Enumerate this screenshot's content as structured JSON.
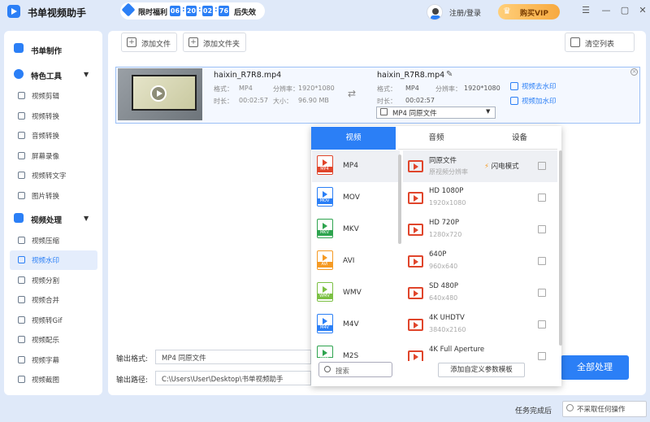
{
  "app": {
    "title": "书单视频助手"
  },
  "promo": {
    "label": "限时福利",
    "days": "06",
    "hours": "20",
    "minutes": "02",
    "seconds": "76",
    "suffix": "后失效"
  },
  "header": {
    "login": "注册/登录",
    "vip": "购买VIP"
  },
  "sidebar": {
    "top_item": "书单制作",
    "groups": [
      {
        "label": "特色工具",
        "items": [
          "视频剪辑",
          "视频转换",
          "音频转换",
          "屏幕录像",
          "视频转文字",
          "图片转换"
        ]
      },
      {
        "label": "视频处理",
        "items": [
          "视频压缩",
          "视频水印",
          "视频分割",
          "视频合并",
          "视频转Gif",
          "视频配乐",
          "视频字幕",
          "视频截图"
        ]
      }
    ],
    "active_item": "视频水印"
  },
  "toolbar": {
    "add_file": "添加文件",
    "add_folder": "添加文件夹",
    "clear_list": "清空列表"
  },
  "file": {
    "source_name": "haixin_R7R8.mp4",
    "source_format_key": "格式：",
    "source_format": "MP4",
    "source_res_key": "分辨率：",
    "source_res": "1920*1080",
    "source_dur_key": "时长：",
    "source_dur": "00:02:57",
    "source_size_key": "大小：",
    "source_size": "96.90 MB",
    "output_name": "haixin_R7R8.mp4",
    "output_format_key": "格式：",
    "output_format": "MP4",
    "output_res_key": "分辨率：",
    "output_res": "1920*1080",
    "output_dur_key": "时长：",
    "output_dur": "00:02:57",
    "output_select": "MP4  同原文件",
    "remove_watermark": "视频去水印",
    "add_watermark": "视频加水印"
  },
  "bottom": {
    "output_format_label": "输出格式:",
    "output_format_value": "MP4  同原文件",
    "output_path_label": "输出路径:",
    "output_path_value": "C:\\Users\\User\\Desktop\\书单视频助手",
    "process_all": "全部处理",
    "after_label": "任务完成后",
    "after_value": "不采取任何操作"
  },
  "dropdown": {
    "tabs": [
      "视频",
      "音频",
      "设备"
    ],
    "active_tab": "视频",
    "formats": [
      {
        "label": "MP4",
        "color": "#e0452b",
        "active": true
      },
      {
        "label": "MOV",
        "color": "#2b7ff6"
      },
      {
        "label": "MKV",
        "color": "#2ea44f"
      },
      {
        "label": "AVI",
        "color": "#f59a23"
      },
      {
        "label": "WMV",
        "color": "#7bc043"
      },
      {
        "label": "M4V",
        "color": "#2b7ff6"
      },
      {
        "label": "M2S",
        "color": "#2ea44f"
      }
    ],
    "search_placeholder": "搜索",
    "resolutions": [
      {
        "title": "同原文件",
        "sub": "原视频分辨率",
        "flash": "闪电模式"
      },
      {
        "title": "HD 1080P",
        "sub": "1920x1080"
      },
      {
        "title": "HD 720P",
        "sub": "1280x720"
      },
      {
        "title": "640P",
        "sub": "960x640"
      },
      {
        "title": "SD 480P",
        "sub": "640x480"
      },
      {
        "title": "4K UHDTV",
        "sub": "3840x2160"
      },
      {
        "title": "4K Full Aperture",
        "sub": ""
      }
    ],
    "custom_button": "添加自定义参数模板"
  }
}
